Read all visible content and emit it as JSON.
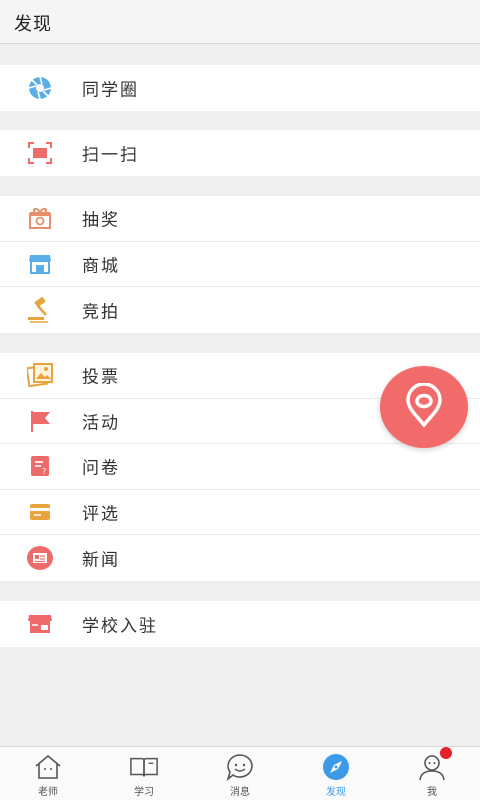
{
  "header": {
    "title": "发现"
  },
  "groups": [
    {
      "items": [
        {
          "label": "同学圈",
          "icon": "aperture-icon"
        }
      ]
    },
    {
      "items": [
        {
          "label": "扫一扫",
          "icon": "scan-icon"
        }
      ]
    },
    {
      "items": [
        {
          "label": "抽奖",
          "icon": "gift-icon"
        },
        {
          "label": "商城",
          "icon": "store-icon"
        },
        {
          "label": "竞拍",
          "icon": "gavel-icon"
        }
      ]
    },
    {
      "items": [
        {
          "label": "投票",
          "icon": "photo-vote-icon"
        },
        {
          "label": "活动",
          "icon": "flag-icon"
        },
        {
          "label": "问卷",
          "icon": "questionnaire-icon"
        },
        {
          "label": "评选",
          "icon": "card-icon"
        },
        {
          "label": "新闻",
          "icon": "news-icon"
        }
      ]
    },
    {
      "items": [
        {
          "label": "学校入驻",
          "icon": "school-store-icon"
        }
      ]
    }
  ],
  "fab": {
    "icon": "location-pin-icon",
    "color": "#f26b6b"
  },
  "tabbar": {
    "tabs": [
      {
        "label": "老师",
        "icon": "house-face-icon"
      },
      {
        "label": "学习",
        "icon": "book-icon"
      },
      {
        "label": "消息",
        "icon": "chat-face-icon"
      },
      {
        "label": "发现",
        "icon": "compass-icon",
        "active": true
      },
      {
        "label": "我",
        "icon": "person-icon",
        "badge": true
      }
    ],
    "active_color": "#3c9be8",
    "badge_color": "#e5212b"
  }
}
